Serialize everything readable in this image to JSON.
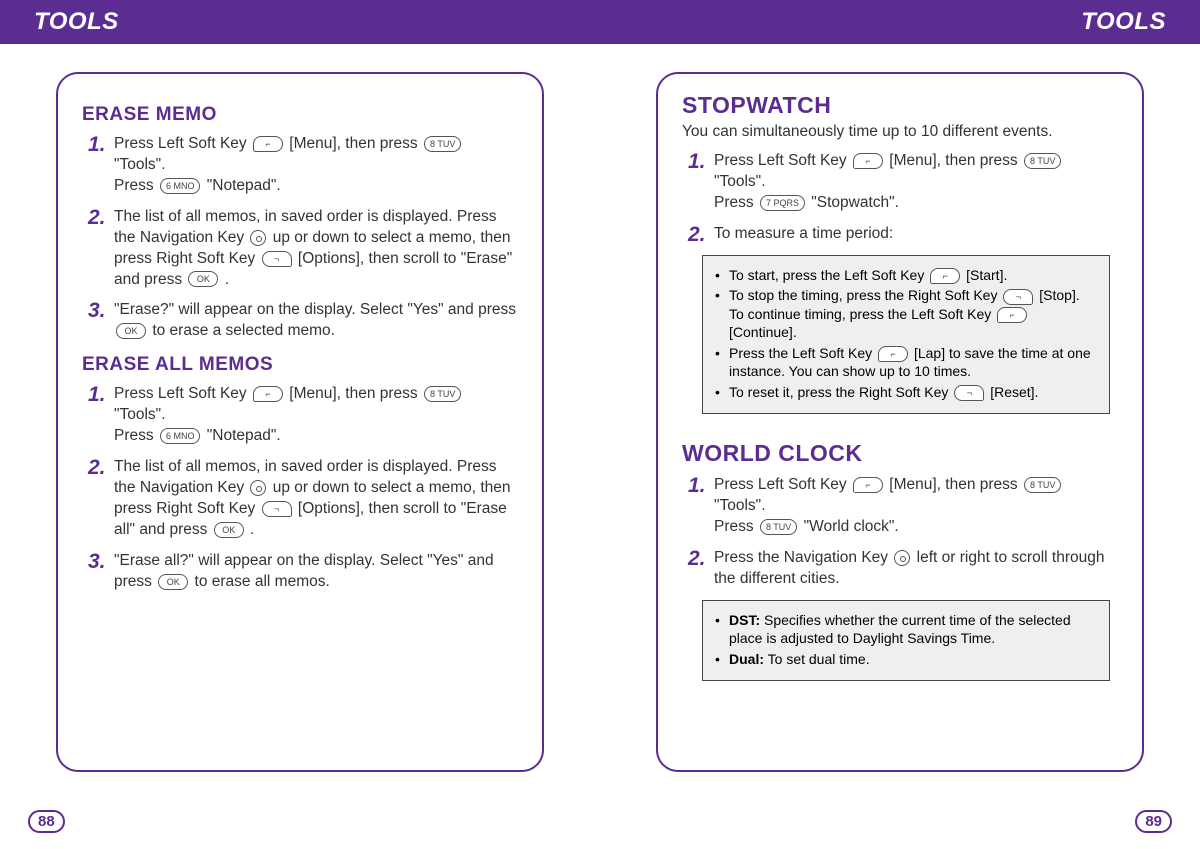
{
  "header": {
    "left_title": "TOOLS",
    "right_title": "TOOLS"
  },
  "pagenum": {
    "left": "88",
    "right": "89"
  },
  "left_page": {
    "sec1_title": "ERASE MEMO",
    "sec1_steps": [
      {
        "pre1": "Press Left Soft Key ",
        "post1": " [Menu], then press ",
        "post2": " \"Tools\".",
        "line2a": "Press ",
        "line2b": " \"Notepad\"."
      },
      {
        "pre1": "The list of all memos, in saved order is displayed. Press the Navigation Key ",
        "mid1": " up or down to select a memo, then press Right Soft Key ",
        "mid2": " [Options], then scroll to \"Erase\" and press ",
        "tail": " ."
      },
      {
        "pre1": "\"Erase?\" will appear on the display. Select \"Yes\" and press ",
        "tail": " to erase a selected memo."
      }
    ],
    "sec2_title": "ERASE ALL MEMOS",
    "sec2_steps": [
      {
        "pre1": "Press Left Soft Key ",
        "post1": " [Menu], then press ",
        "post2": " \"Tools\".",
        "line2a": "Press ",
        "line2b": " \"Notepad\"."
      },
      {
        "pre1": "The list of all memos, in saved order is displayed. Press the Navigation Key ",
        "mid1": " up or down to select a memo, then press Right Soft Key ",
        "mid2": " [Options], then scroll to \"Erase all\" and press ",
        "tail": " ."
      },
      {
        "pre1": "\"Erase all?\" will appear on the display. Select \"Yes\" and press ",
        "tail": " to erase all memos."
      }
    ]
  },
  "right_page": {
    "sw_title": "STOPWATCH",
    "sw_intro": "You can simultaneously time up to 10 different events.",
    "sw_steps": [
      {
        "pre1": "Press Left Soft Key ",
        "post1": " [Menu], then press ",
        "post2": " \"Tools\".",
        "line2a": "Press ",
        "line2b": " \"Stopwatch\"."
      },
      {
        "text": "To measure a time period:"
      }
    ],
    "sw_box": [
      {
        "a": "To start, press the Left Soft Key ",
        "b": " [Start]."
      },
      {
        "a": "To stop the timing, press the Right Soft Key ",
        "b": " [Stop]. To continue timing, press the Left Soft Key ",
        "c": " [Continue]."
      },
      {
        "a": "Press the Left Soft Key ",
        "b": " [Lap] to save the time at one instance. You can show up to 10 times."
      },
      {
        "a": "To reset it, press the Right Soft Key ",
        "b": " [Reset]."
      }
    ],
    "wc_title": "WORLD CLOCK",
    "wc_steps": [
      {
        "pre1": "Press Left Soft Key ",
        "post1": " [Menu], then press ",
        "post2": " \"Tools\".",
        "line2a": "Press ",
        "line2b": " \"World clock\"."
      },
      {
        "pre1": "Press the Navigation Key ",
        "tail": " left or right to scroll through the different cities."
      }
    ],
    "wc_box": [
      {
        "label": "DST:",
        "text": " Specifies whether the current time of the selected place is adjusted to Daylight Savings Time."
      },
      {
        "label": "Dual:",
        "text": " To set dual time."
      }
    ]
  }
}
